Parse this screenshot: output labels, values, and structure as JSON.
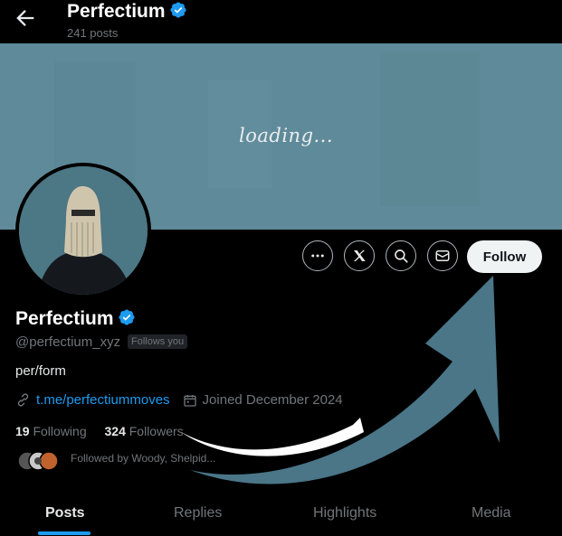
{
  "header": {
    "title": "Perfectium",
    "post_count": "241 posts",
    "back_icon": "arrow-left-icon"
  },
  "banner": {
    "text": "loading..."
  },
  "actions": {
    "more_icon": "more-icon",
    "x_icon": "x-logo-icon",
    "search_icon": "search-icon",
    "message_icon": "envelope-icon",
    "follow_label": "Follow"
  },
  "profile": {
    "name": "Perfectium",
    "handle": "@perfectium_xyz",
    "follows_you": "Follows you",
    "bio": "per/form",
    "link": "t.me/perfectiummoves",
    "joined": "Joined December 2024",
    "following_count": "19",
    "following_label": "Following",
    "followers_count": "324",
    "followers_label": "Followers",
    "followed_by": "Followed by Woody, Shelpid..."
  },
  "tabs": [
    {
      "label": "Posts"
    },
    {
      "label": "Replies"
    },
    {
      "label": "Highlights"
    },
    {
      "label": "Media"
    }
  ],
  "colors": {
    "accent": "#1d9bf0",
    "banner": "#5f8a99",
    "annotation_arrow": "#4a7688"
  }
}
